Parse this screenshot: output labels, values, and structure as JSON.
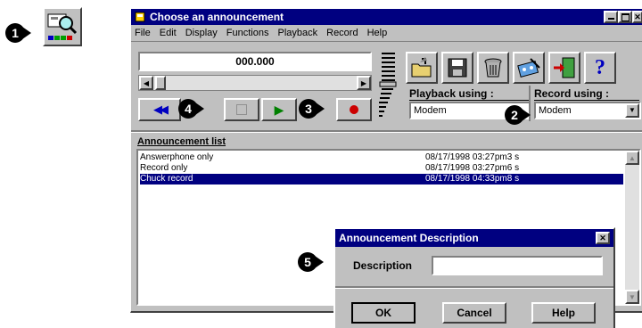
{
  "callouts": [
    "1",
    "2",
    "3",
    "4",
    "5"
  ],
  "main_window": {
    "title": "Choose an announcement",
    "menu": [
      "File",
      "Edit",
      "Display",
      "Functions",
      "Playback",
      "Record",
      "Help"
    ],
    "counter": "000.000",
    "playback_label": "Playback using :",
    "playback_value": "Modem",
    "record_label": "Record using :",
    "record_value": "Modem",
    "list_label": "Announcement list",
    "list_rows": [
      {
        "name": "Answerphone only",
        "date": "08/17/1998 03:27pm3 s"
      },
      {
        "name": "Record only",
        "date": "08/17/1998 03:27pm6 s"
      },
      {
        "name": "Chuck record",
        "date": "08/17/1998 04:33pm8 s"
      }
    ],
    "help_glyph": "?"
  },
  "dialog": {
    "title": "Announcement Description",
    "description_label": "Description",
    "description_value": "",
    "ok_label": "OK",
    "cancel_label": "Cancel",
    "help_label": "Help",
    "close_glyph": "✕"
  },
  "colors": {
    "titlebar": "#000080",
    "face": "#c0c0c0",
    "selection": "#000080",
    "play": "#008000",
    "record": "#cc0000",
    "rewind": "#0000c0"
  }
}
